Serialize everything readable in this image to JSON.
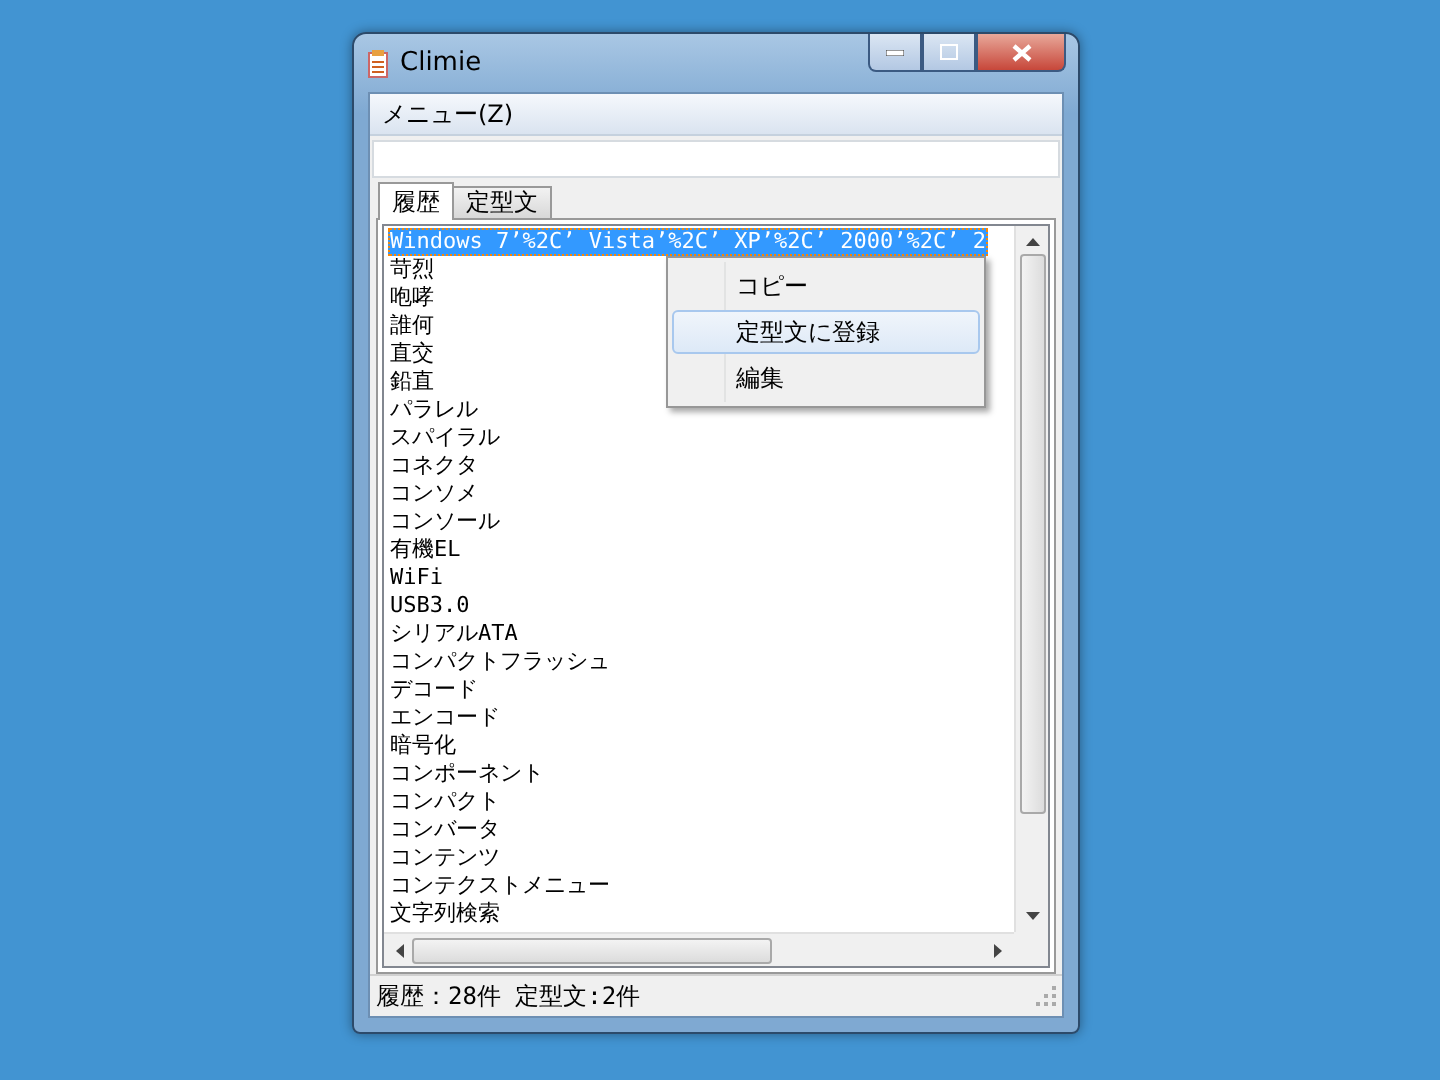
{
  "window": {
    "title": "Climie"
  },
  "menu_bar": {
    "label": "メニュー(Z)"
  },
  "tabs": [
    {
      "label": "履歴",
      "selected": true
    },
    {
      "label": "定型文",
      "selected": false
    }
  ],
  "list": {
    "items": [
      {
        "text": "Windows 7’%2C’ Vista’%2C’ XP’%2C’ 2000’%2C’ 2",
        "selected": true
      },
      {
        "text": "苛烈",
        "selected": false
      },
      {
        "text": "咆哮",
        "selected": false
      },
      {
        "text": "誰何",
        "selected": false
      },
      {
        "text": "直交",
        "selected": false
      },
      {
        "text": "鉛直",
        "selected": false
      },
      {
        "text": "パラレル",
        "selected": false
      },
      {
        "text": "スパイラル",
        "selected": false
      },
      {
        "text": "コネクタ",
        "selected": false
      },
      {
        "text": "コンソメ",
        "selected": false
      },
      {
        "text": "コンソール",
        "selected": false
      },
      {
        "text": "有機EL",
        "selected": false
      },
      {
        "text": "WiFi",
        "selected": false
      },
      {
        "text": "USB3.0",
        "selected": false
      },
      {
        "text": "シリアルATA",
        "selected": false
      },
      {
        "text": "コンパクトフラッシュ",
        "selected": false
      },
      {
        "text": "デコード",
        "selected": false
      },
      {
        "text": "エンコード",
        "selected": false
      },
      {
        "text": "暗号化",
        "selected": false
      },
      {
        "text": "コンポーネント",
        "selected": false
      },
      {
        "text": "コンパクト",
        "selected": false
      },
      {
        "text": "コンバータ",
        "selected": false
      },
      {
        "text": "コンテンツ",
        "selected": false
      },
      {
        "text": "コンテクストメニュー",
        "selected": false
      },
      {
        "text": "文字列検索",
        "selected": false
      }
    ]
  },
  "context_menu": {
    "items": [
      {
        "label": "コピー",
        "selected": false
      },
      {
        "label": "定型文に登録",
        "selected": true
      },
      {
        "label": "編集",
        "selected": false
      }
    ]
  },
  "status_bar": {
    "text": "履歴：28件 定型文:2件"
  }
}
